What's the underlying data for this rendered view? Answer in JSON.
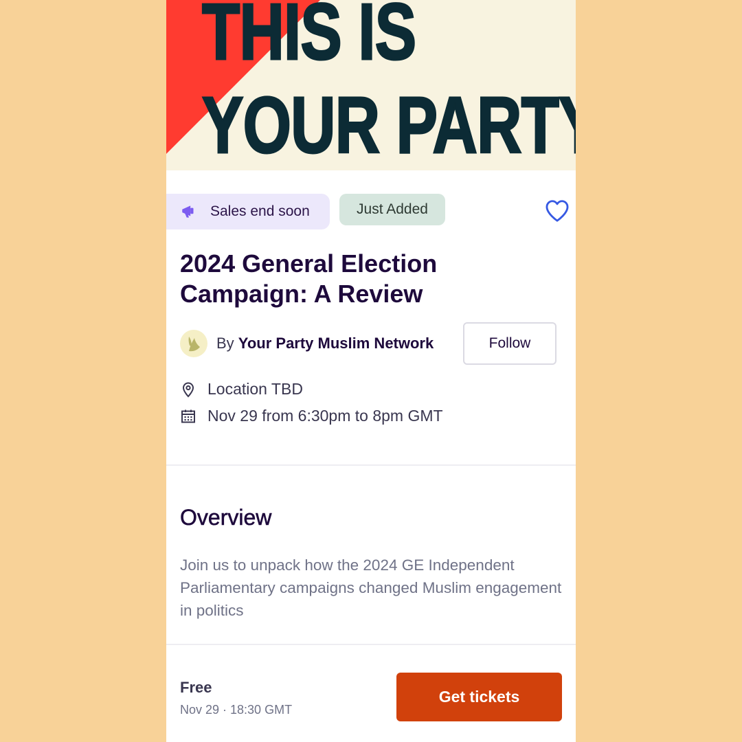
{
  "banner": {
    "line1": "THIS IS",
    "line2": "YOUR PARTY."
  },
  "badges": {
    "sales": "Sales end soon",
    "new": "Just Added"
  },
  "event": {
    "title": "2024 General Election Campaign: A Review"
  },
  "organizer": {
    "prefix": "By ",
    "name": "Your Party Muslim Network",
    "follow_label": "Follow"
  },
  "details": {
    "location": "Location TBD",
    "date": "Nov 29 from 6:30pm to 8pm GMT"
  },
  "overview": {
    "heading": "Overview",
    "body": "Join us to unpack how the 2024 GE Independent Parliamentary campaigns changed Muslim engagement in politics"
  },
  "footer": {
    "price": "Free",
    "datetime": "Nov 29 · 18:30 GMT",
    "cta_label": "Get tickets"
  },
  "icons": {
    "badge": "megaphone-icon",
    "save": "heart-icon",
    "location": "map-pin-icon",
    "date": "calendar-icon"
  },
  "colors": {
    "page_background": "#f8d298",
    "banner_background": "#f8f3e0",
    "banner_accent": "#ff3b30",
    "banner_text": "#0c2b35",
    "title": "#1e0a3c",
    "sales_badge_bg": "#ece8fb",
    "megaphone": "#7c5cf0",
    "new_badge_bg": "#d6e6de",
    "heart": "#3659e3",
    "cta": "#d1410c"
  }
}
